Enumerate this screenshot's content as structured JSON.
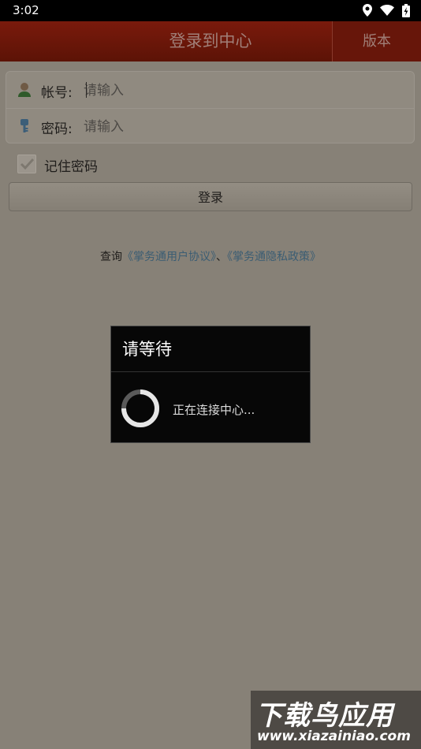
{
  "status_bar": {
    "time": "3:02",
    "icons": [
      "location-icon",
      "wifi-icon",
      "battery-icon"
    ]
  },
  "header": {
    "title": "登录到中心",
    "version_button": "版本"
  },
  "form": {
    "account": {
      "label": "帐号:",
      "placeholder": "请输入"
    },
    "password": {
      "label": "密码:",
      "placeholder": "请输入"
    },
    "remember_label": "记住密码",
    "remember_checked": true,
    "login_button": "登录"
  },
  "agreement": {
    "prefix": "查询",
    "link1": "《掌务通用户协议》",
    "separator": "、",
    "link2": "《掌务通隐私政策》"
  },
  "dialog": {
    "title": "请等待",
    "message": "正在连接中心..."
  },
  "watermark": {
    "line1": "下载鸟应用",
    "line2": "www.xiazainiao.com"
  },
  "colors": {
    "header_bg": "#6e170a",
    "overlay_bg": "#878177",
    "link": "#3b5d73",
    "dialog_bg": "#070707"
  }
}
